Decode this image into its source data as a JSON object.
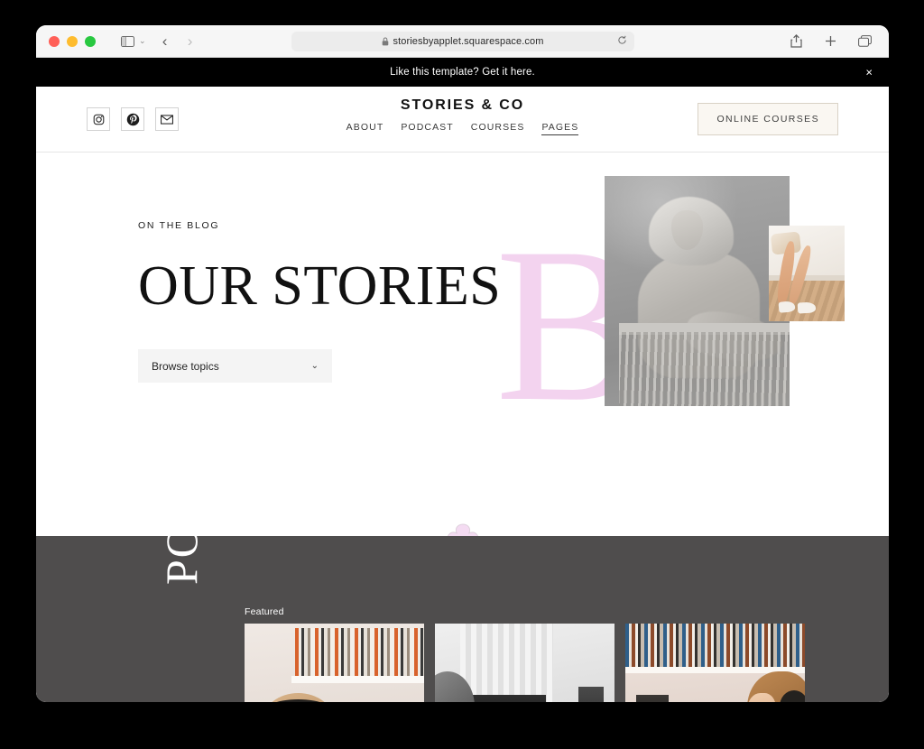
{
  "browser": {
    "traffic_lights": [
      "close",
      "minimize",
      "maximize"
    ],
    "url": "storiesbyapplet.squarespace.com",
    "lock_icon": "lock-icon",
    "reload_icon": "reload-icon",
    "sidebar_icon": "sidebar-toggle-icon",
    "sidebar_chevron": "⌄",
    "back_icon": "‹",
    "forward_icon": "›",
    "share_icon": "share-icon",
    "new_tab_icon": "plus-icon",
    "tabs_icon": "tab-overview-icon"
  },
  "promo": {
    "text": "Like this template? Get it here.",
    "close_label": "×",
    "background": "#000000",
    "text_color": "#ffffff"
  },
  "site_header": {
    "logo": "STORIES & CO",
    "socials": [
      {
        "name": "instagram-icon",
        "label": "Instagram"
      },
      {
        "name": "pinterest-icon",
        "label": "Pinterest"
      },
      {
        "name": "email-icon",
        "label": "Email"
      }
    ],
    "nav": [
      {
        "label": "ABOUT",
        "active": false
      },
      {
        "label": "PODCAST",
        "active": false
      },
      {
        "label": "COURSES",
        "active": false
      },
      {
        "label": "PAGES",
        "active": true
      }
    ],
    "cta_label": "ONLINE COURSES",
    "cta_background": "#faf7f2",
    "cta_border": "#d9d2c6"
  },
  "hero": {
    "eyebrow": "ON THE BLOG",
    "title": "OUR STORIES",
    "select_label": "Browse topics",
    "select_chevron": "⌄",
    "decorative_letter": "B",
    "letter_color": "#f3d3ef",
    "main_photo_alt": "Black and white photo of a woman leaning on a railing",
    "inset_photo_alt": "Legs in strappy heels on a wooden floor"
  },
  "divider": {
    "shape": "clover-flower",
    "color": "#f4dbf2",
    "stroke": "#ded0dc"
  },
  "featured": {
    "vertical_word": "PODCAST",
    "label": "Featured",
    "background": "#4f4d4d",
    "cards": [
      {
        "alt": "Person wearing headphones in front of a bookshelf"
      },
      {
        "alt": "Desk setup with monitor, keyboard and speaker"
      },
      {
        "alt": "Woman with headphones beside a bookshelf"
      }
    ]
  }
}
